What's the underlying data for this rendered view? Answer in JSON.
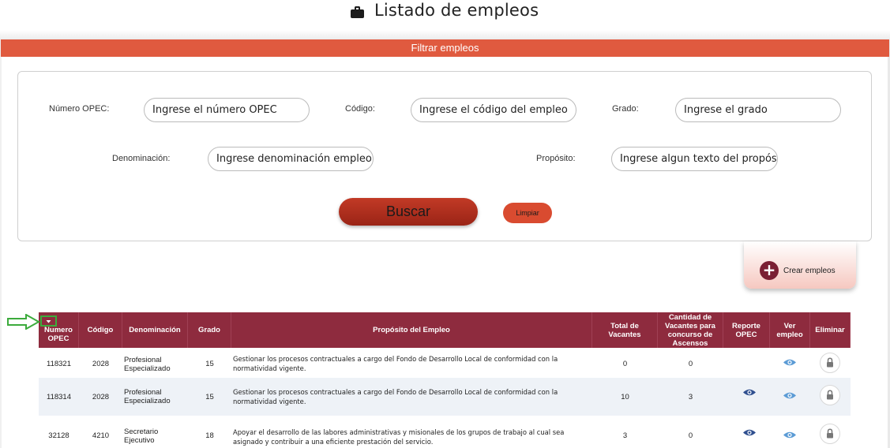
{
  "header": {
    "title": "Listado de empleos",
    "icon": "briefcase-icon"
  },
  "filter": {
    "bar_label": "Filtrar empleos",
    "fields": [
      {
        "label": "Número OPEC:",
        "placeholder": "Ingrese el número OPEC"
      },
      {
        "label": "Código:",
        "placeholder": "Ingrese el código del empleo"
      },
      {
        "label": "Grado:",
        "placeholder": "Ingrese el grado"
      },
      {
        "label": "Denominación:",
        "placeholder": "Ingrese denominación empleo"
      },
      {
        "label": "Propósito:",
        "placeholder": "Ingrese algun texto del propósito"
      }
    ],
    "buscar_label": "Buscar",
    "limpiar_label": "Limpiar"
  },
  "crear": {
    "label": "Crear empleos",
    "icon": "plus-icon"
  },
  "table": {
    "headers": [
      "Numero OPEC",
      "Código",
      "Denominación",
      "Grado",
      "Propósito del Empleo",
      "Total de Vacantes",
      "Cantidad de Vacantes para concurso de Ascensos",
      "Reporte OPEC",
      "Ver empleo",
      "Eliminar"
    ],
    "rows": [
      {
        "opec": "118321",
        "codigo": "2028",
        "denominacion": "Profesional Especializado",
        "grado": "15",
        "proposito": "Gestionar los procesos contractuales a cargo del Fondo de Desarrollo Local de conformidad con la normatividad vigente.",
        "total": "0",
        "ascensos": "0",
        "reporte": false
      },
      {
        "opec": "118314",
        "codigo": "2028",
        "denominacion": "Profesional Especializado",
        "grado": "15",
        "proposito": "Gestionar los procesos contractuales a cargo del Fondo de Desarrollo Local de conformidad con la normatividad vigente.",
        "total": "10",
        "ascensos": "3",
        "reporte": true
      },
      {
        "opec": "32128",
        "codigo": "4210",
        "denominacion": "Secretario Ejecutivo",
        "grado": "18",
        "proposito": "Apoyar el desarrollo de las labores administrativas y misionales de los grupos de trabajo al cual sea asignado y contribuir a una eficiente prestación del servicio.",
        "total": "3",
        "ascensos": "0",
        "reporte": true
      }
    ]
  },
  "colors": {
    "accent": "#e05a3f",
    "header_bg": "#8e2b3e",
    "eye_dark": "#2f4f8f",
    "eye_light": "#5b9bd5"
  }
}
